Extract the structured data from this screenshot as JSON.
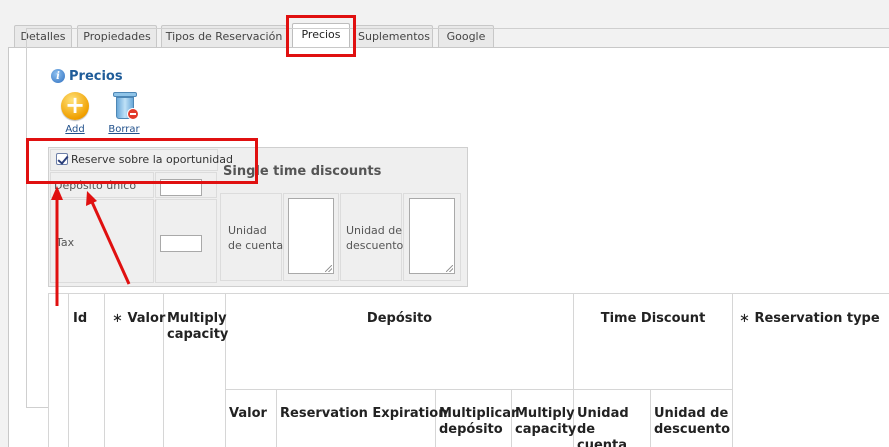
{
  "tabs": [
    {
      "label": "Detalles"
    },
    {
      "label": "Propiedades"
    },
    {
      "label": "Tipos de Reservación"
    },
    {
      "label": "Precios"
    },
    {
      "label": "Suplementos"
    },
    {
      "label": "Google"
    }
  ],
  "section": {
    "title": "Precios"
  },
  "toolbar": {
    "add_label": "Add",
    "delete_label": "Borrar"
  },
  "options": {
    "reserve_label": "Reserve sobre la oportunidad",
    "reserve_checked": true,
    "deposit_label": "Depósito único",
    "tax_label": "Tax",
    "single_time_title": "Single time discounts",
    "unit_account_label": "Unidad de cuenta",
    "unit_discount_label": "Unidad de descuento"
  },
  "table": {
    "id": "Id",
    "valor": "Valor",
    "multiply_capacity": "Multiply capacity",
    "deposito": "Depósito",
    "time_discount": "Time Discount",
    "reservation_type": "Reservation type",
    "sub": {
      "valor": "Valor",
      "reservation_expiration": "Reservation Expiration",
      "multiplicar_deposito": "Multiplicar depósito",
      "multiply_capacity": "Multiply capacity",
      "unidad_cuenta": "Unidad de cuenta",
      "unidad_descuento": "Unidad de descuento"
    },
    "required_mark": "∗"
  },
  "colors": {
    "annotation": "#e01010",
    "link": "#1f4f8a",
    "legend": "#1f5c99"
  }
}
